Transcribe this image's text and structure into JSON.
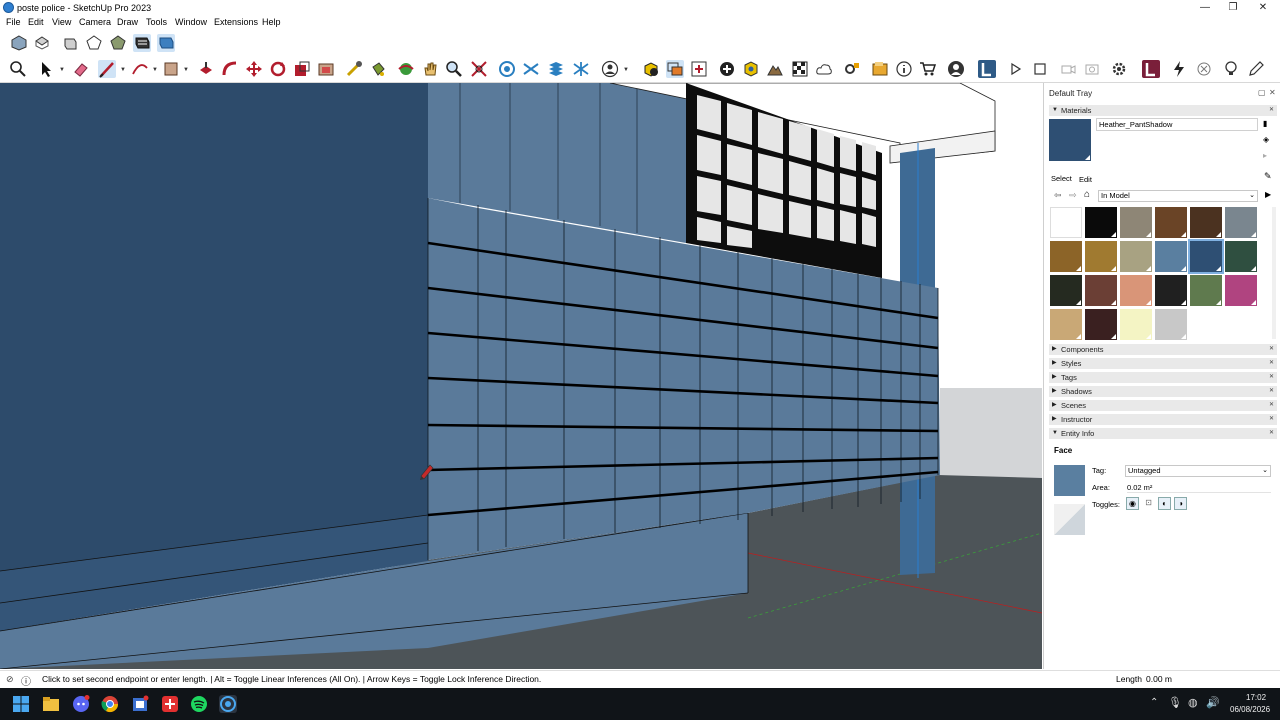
{
  "window": {
    "title": "poste police - SketchUp Pro 2023",
    "minimize": "—",
    "maximize": "❐",
    "close": "✕"
  },
  "menu": [
    "File",
    "Edit",
    "View",
    "Camera",
    "Draw",
    "Tools",
    "Window",
    "Extensions",
    "Help"
  ],
  "tray": {
    "title": "Default Tray",
    "materials": {
      "header": "Materials",
      "current_material": "Heather_PantShadow",
      "current_color": "#2e4f73",
      "tab_select": "Select",
      "tab_edit": "Edit",
      "collection": "In Model",
      "swatches": [
        "#ffffff",
        "#0a0a0a",
        "#8e8676",
        "#6a4426",
        "#4b3220",
        "#7a868f",
        "#8c6428",
        "#a07a30",
        "#a8a282",
        "#5a7fa0",
        "#2e4f73",
        "#2f4f40",
        "#252a20",
        "#6b3f35",
        "#d99578",
        "#202020",
        "#5f7a4e",
        "#b04480",
        "#c9a876",
        "#3a2020",
        "#f4f4c4",
        "#c8c8c8"
      ],
      "selected_index": 10
    },
    "panels": [
      "Components",
      "Styles",
      "Tags",
      "Shadows",
      "Scenes",
      "Instructor",
      "Entity Info"
    ],
    "entity_info": {
      "type": "Face",
      "tag_label": "Tag:",
      "tag_value": "Untagged",
      "area_label": "Area:",
      "area_value": "0.02 m²",
      "toggles_label": "Toggles:",
      "front_color": "#5a7fa0"
    }
  },
  "status": {
    "message": "Click to set second endpoint or enter length. | Alt = Toggle Linear Inferences (All On). | Arrow Keys = Toggle Lock Inference Direction.",
    "measure_label": "Length",
    "measure_value": "0.00 m"
  },
  "taskbar": {
    "time": "17:02",
    "date": "06/08/2026"
  },
  "colors": {
    "wall_dark": "#2d4b6b",
    "wall_mid": "#5a7a9a",
    "floor": "#4d5458",
    "sky": "#d8dde0"
  }
}
